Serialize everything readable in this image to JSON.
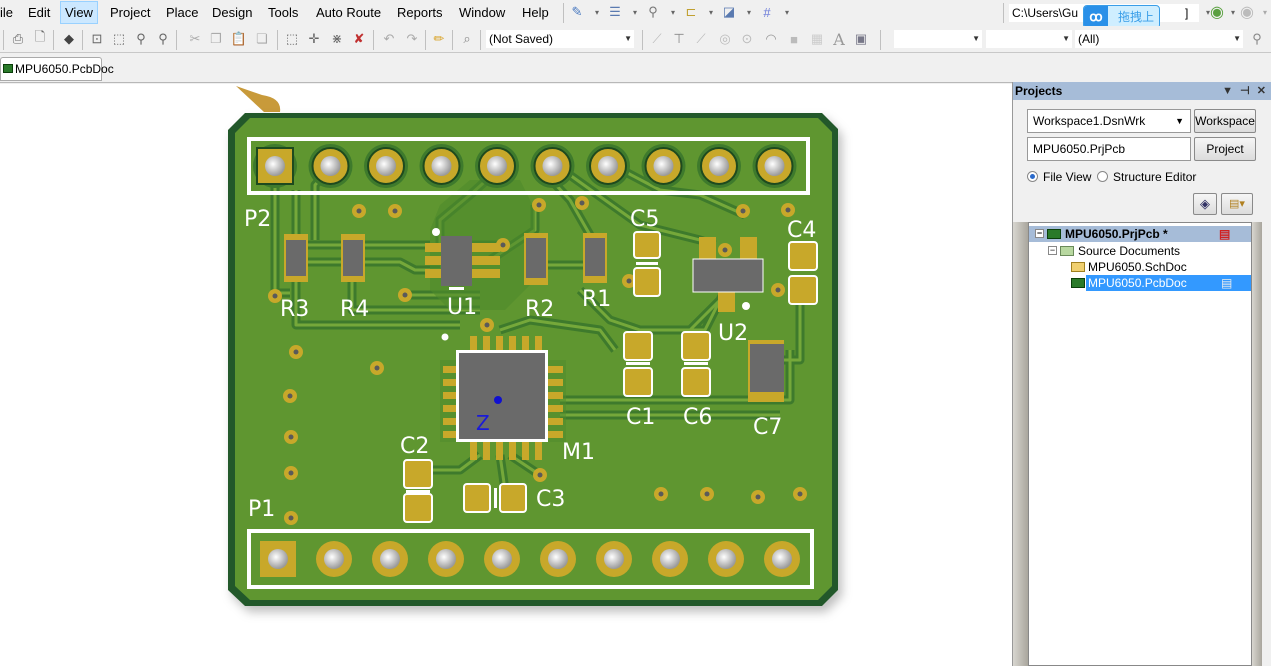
{
  "menubar": {
    "items": [
      {
        "label": "ile",
        "key": "file"
      },
      {
        "label": "Edit",
        "key": "edit"
      },
      {
        "label": "View",
        "key": "view",
        "active": true
      },
      {
        "label": "Project",
        "key": "project"
      },
      {
        "label": "Place",
        "key": "place"
      },
      {
        "label": "Design",
        "key": "design"
      },
      {
        "label": "Tools",
        "key": "tools"
      },
      {
        "label": "Auto Route",
        "key": "auto-route"
      },
      {
        "label": "Reports",
        "key": "reports"
      },
      {
        "label": "Window",
        "key": "window"
      },
      {
        "label": "Help",
        "key": "help"
      }
    ],
    "path_combo": "C:\\Users\\Gu",
    "path_combo_tail": "]"
  },
  "upload_popup": {
    "label": "拖拽上传"
  },
  "toolbar": {
    "snapshot_combo": "(Not Saved)",
    "filter_combo": "(All)"
  },
  "doc_tabs": [
    {
      "label": "MPU6050.PcbDoc"
    }
  ],
  "projects_panel": {
    "title": "Projects",
    "workspace_field": "Workspace1.DsnWrk",
    "workspace_button": "Workspace",
    "project_field": "MPU6050.PrjPcb",
    "project_button": "Project",
    "view_options": [
      {
        "label": "File View",
        "selected": true
      },
      {
        "label": "Structure Editor",
        "selected": false
      }
    ],
    "tree": {
      "project": "MPU6050.PrjPcb *",
      "folder": "Source Documents",
      "documents": [
        {
          "label": "MPU6050.SchDoc",
          "type": "sch",
          "selected": false
        },
        {
          "label": "MPU6050.PcbDoc",
          "type": "pcb",
          "selected": true
        }
      ]
    }
  },
  "pcb": {
    "colors": {
      "board": "#5f9630",
      "board_edge": "#24582b",
      "copper": "#c8a82a",
      "silk": "#ffffff",
      "body": "#6a6a6a"
    },
    "designators": {
      "P1": "P1",
      "P2": "P2",
      "R1": "R1",
      "R2": "R2",
      "R3": "R3",
      "R4": "R4",
      "U1": "U1",
      "U2": "U2",
      "M1": "M1",
      "C1": "C1",
      "C2": "C2",
      "C3": "C3",
      "C4": "C4",
      "C5": "C5",
      "C6": "C6",
      "C7": "C7"
    },
    "origin_marker": "Z"
  }
}
